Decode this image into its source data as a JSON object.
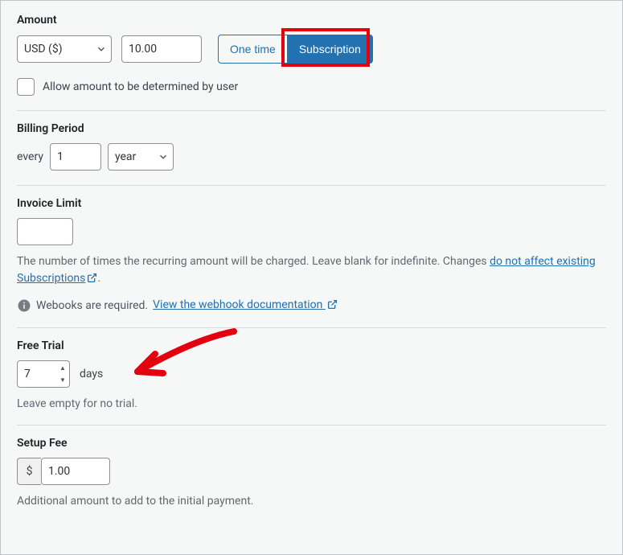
{
  "amount": {
    "label": "Amount",
    "currency": "USD ($)",
    "value": "10.00",
    "one_time_label": "One time",
    "subscription_label": "Subscription",
    "allow_user_label": "Allow amount to be determined by user"
  },
  "billing": {
    "label": "Billing Period",
    "every": "every",
    "count": "1",
    "unit": "year"
  },
  "invoice": {
    "label": "Invoice Limit",
    "value": "",
    "helper_pre": "The number of times the recurring amount will be charged. Leave blank for indefinite. Changes ",
    "helper_link": "do not affect existing Subscriptions",
    "webhooks_text": "Webooks are required. ",
    "webhooks_link": "View the webhook documentation "
  },
  "trial": {
    "label": "Free Trial",
    "value": "7",
    "days": "days",
    "helper": "Leave empty for no trial."
  },
  "setup": {
    "label": "Setup Fee",
    "prefix": "$",
    "value": "1.00",
    "helper": "Additional amount to add to the initial payment."
  }
}
